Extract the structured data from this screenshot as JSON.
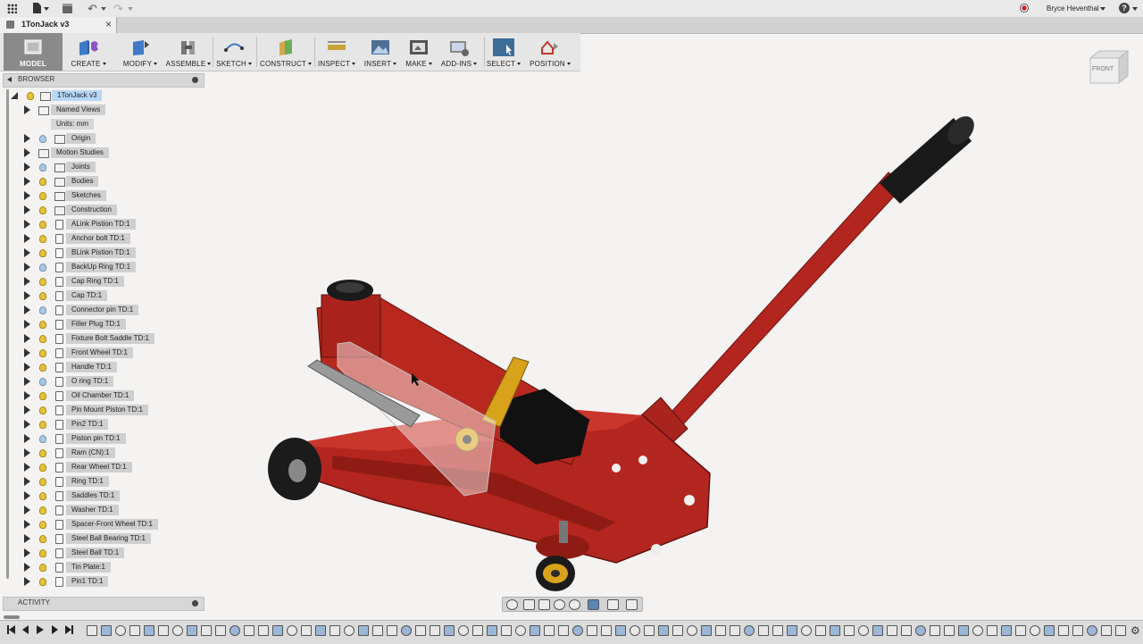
{
  "window": {
    "user_name": "Bryce Heventhal",
    "document_tab": "1TonJack v3"
  },
  "toolbar": {
    "groups": [
      {
        "label": "MODEL",
        "icon": "model-workspace-icon"
      },
      {
        "label": "CREATE",
        "icon": "create-box-icon"
      },
      {
        "label": "MODIFY",
        "icon": "modify-icon"
      },
      {
        "label": "ASSEMBLE",
        "icon": "assemble-icon"
      },
      {
        "label": "SKETCH",
        "icon": "sketch-icon"
      },
      {
        "label": "CONSTRUCT",
        "icon": "construct-plane-icon"
      },
      {
        "label": "INSPECT",
        "icon": "inspect-measure-icon"
      },
      {
        "label": "INSERT",
        "icon": "insert-image-icon"
      },
      {
        "label": "MAKE",
        "icon": "make-print-icon"
      },
      {
        "label": "ADD-INS",
        "icon": "add-ins-icon"
      },
      {
        "label": "SELECT",
        "icon": "select-icon"
      },
      {
        "label": "POSITION",
        "icon": "position-icon"
      }
    ]
  },
  "browser": {
    "title": "BROWSER",
    "root": "1TonJack v3",
    "items": [
      {
        "label": "Named Views",
        "type": "folder",
        "bulb": "none"
      },
      {
        "label": "Units: mm",
        "type": "units",
        "bulb": "none"
      },
      {
        "label": "Origin",
        "type": "folder",
        "bulb": "off"
      },
      {
        "label": "Motion Studies",
        "type": "folder",
        "bulb": "none"
      },
      {
        "label": "Joints",
        "type": "folder",
        "bulb": "off"
      },
      {
        "label": "Bodies",
        "type": "folder",
        "bulb": "on"
      },
      {
        "label": "Sketches",
        "type": "folder",
        "bulb": "on"
      },
      {
        "label": "Construction",
        "type": "folder",
        "bulb": "on"
      },
      {
        "label": "ALink Pistion TD:1",
        "type": "component",
        "bulb": "on"
      },
      {
        "label": "Anchor bolt TD:1",
        "type": "component",
        "bulb": "on"
      },
      {
        "label": "BLink Pistion TD:1",
        "type": "component",
        "bulb": "on"
      },
      {
        "label": "BackUp Ring TD:1",
        "type": "component",
        "bulb": "off"
      },
      {
        "label": "Cap Ring TD:1",
        "type": "component",
        "bulb": "on"
      },
      {
        "label": "Cap TD:1",
        "type": "component",
        "bulb": "on"
      },
      {
        "label": "Connector pin TD:1",
        "type": "component",
        "bulb": "off"
      },
      {
        "label": "Filler Plug TD:1",
        "type": "component",
        "bulb": "on"
      },
      {
        "label": "Fixture Bolt Saddle TD:1",
        "type": "component",
        "bulb": "on"
      },
      {
        "label": "Front Wheel TD:1",
        "type": "component",
        "bulb": "on"
      },
      {
        "label": "Handle TD:1",
        "type": "component",
        "bulb": "on"
      },
      {
        "label": "O ring TD:1",
        "type": "component",
        "bulb": "off"
      },
      {
        "label": "Oil Chamber TD:1",
        "type": "component",
        "bulb": "on"
      },
      {
        "label": "Pin Mount Piston TD:1",
        "type": "component",
        "bulb": "on"
      },
      {
        "label": "Pin2 TD:1",
        "type": "component",
        "bulb": "on"
      },
      {
        "label": "Piston pin TD:1",
        "type": "component",
        "bulb": "off"
      },
      {
        "label": "Ram (CN):1",
        "type": "component",
        "bulb": "on"
      },
      {
        "label": "Rear Wheel TD:1",
        "type": "component",
        "bulb": "on"
      },
      {
        "label": "Ring TD:1",
        "type": "component",
        "bulb": "on"
      },
      {
        "label": "Saddles TD:1",
        "type": "component",
        "bulb": "on"
      },
      {
        "label": "Washer TD:1",
        "type": "component",
        "bulb": "on"
      },
      {
        "label": "Spacer-Front Wheel TD:1",
        "type": "component",
        "bulb": "on"
      },
      {
        "label": "Steel Ball Bearing TD:1",
        "type": "component",
        "bulb": "on"
      },
      {
        "label": "Steel Ball TD:1",
        "type": "component",
        "bulb": "on"
      },
      {
        "label": "Tin Plate:1",
        "type": "component",
        "bulb": "on"
      },
      {
        "label": "Pin1 TD:1",
        "type": "component",
        "bulb": "on"
      }
    ]
  },
  "activity": {
    "title": "ACTIVITY"
  },
  "viewcube": {
    "face": "FRONT"
  },
  "colors": {
    "jack_red": "#b3261f",
    "handle_grip": "#1a1a1a",
    "saddle_yellow": "#d9a21b",
    "accent_blue": "#4a7fc0"
  }
}
